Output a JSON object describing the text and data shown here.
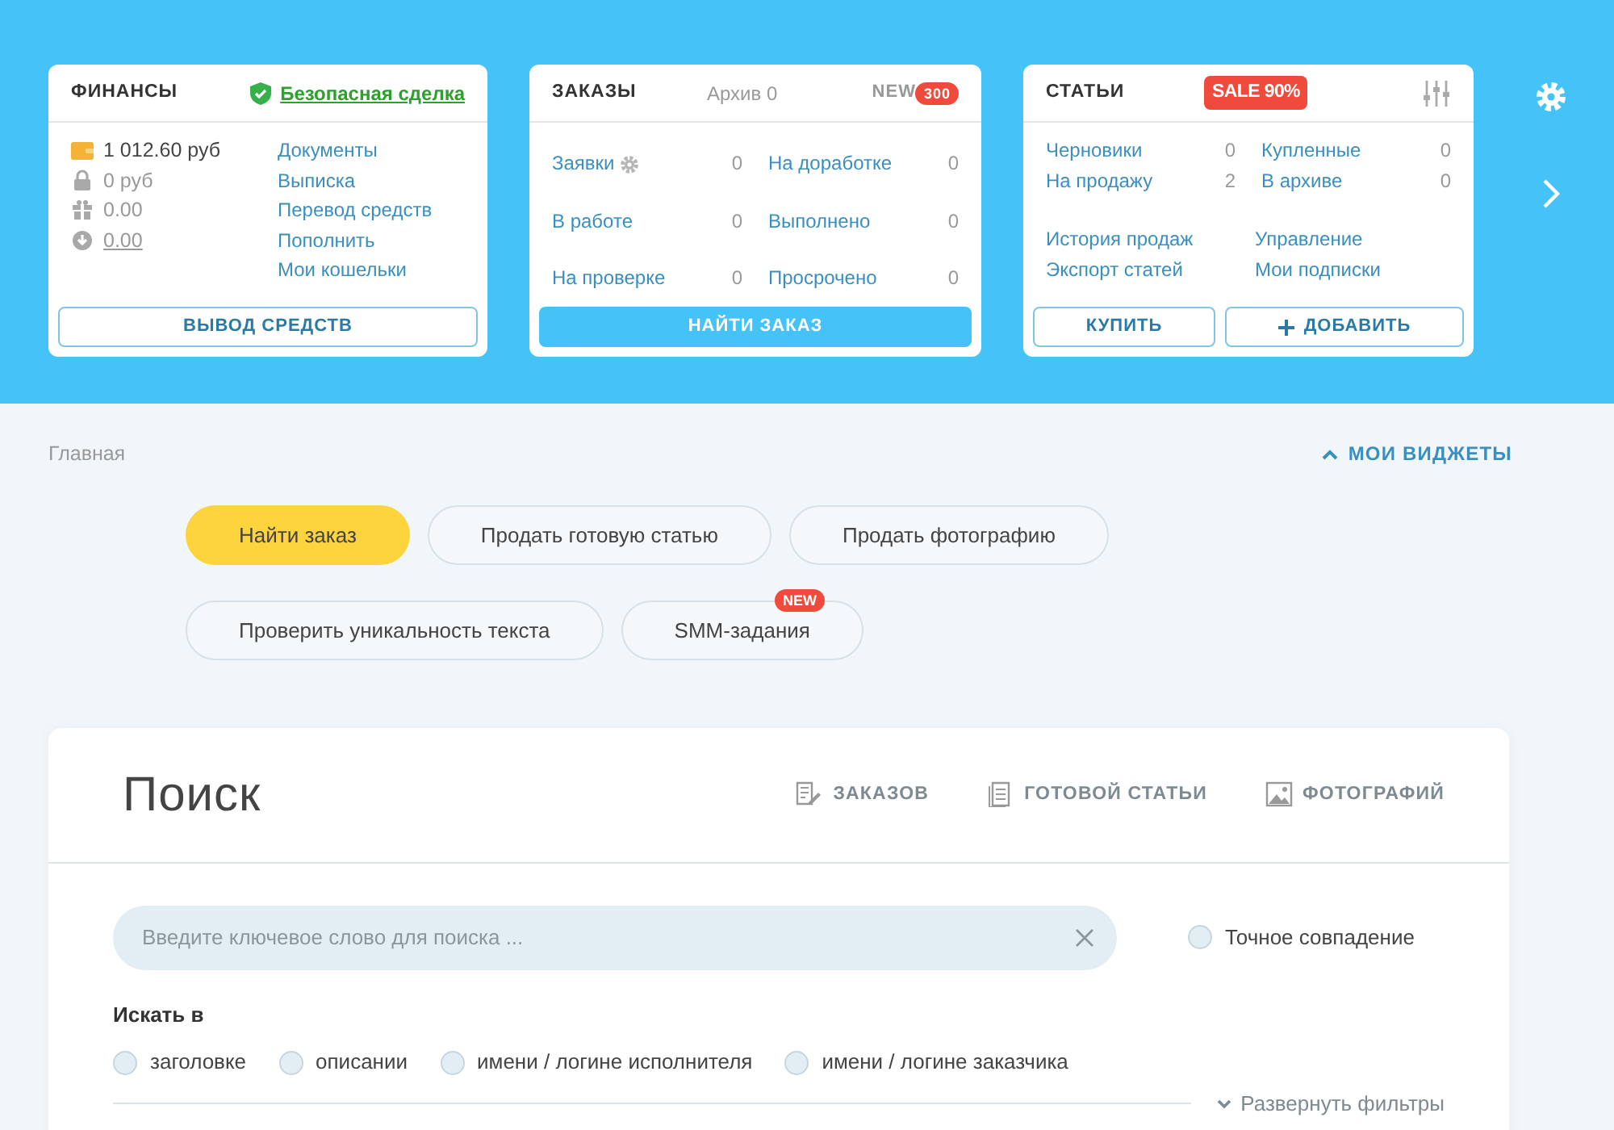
{
  "finance": {
    "title": "ФИНАНСЫ",
    "secure_link": "Безопасная сделка",
    "balances": [
      {
        "kind": "wallet",
        "value": "1 012.60 руб",
        "underlined": false
      },
      {
        "kind": "lock",
        "value": "0 руб",
        "underlined": false
      },
      {
        "kind": "gift",
        "value": "0.00",
        "underlined": false
      },
      {
        "kind": "download",
        "value": "0.00",
        "underlined": true
      }
    ],
    "links": [
      "Документы",
      "Выписка",
      "Перевод средств",
      "Пополнить",
      "Мои кошельки"
    ],
    "button": "ВЫВОД СРЕДСТВ"
  },
  "orders": {
    "title": "ЗАКАЗЫ",
    "archive": "Архив 0",
    "new_label": "NEW",
    "new_count": "300",
    "stats": [
      {
        "label": "Заявки",
        "value": "0",
        "gear": true
      },
      {
        "label": "На доработке",
        "value": "0",
        "gear": false
      },
      {
        "label": "В работе",
        "value": "0",
        "gear": false
      },
      {
        "label": "Выполнено",
        "value": "0",
        "gear": false
      },
      {
        "label": "На проверке",
        "value": "0",
        "gear": false
      },
      {
        "label": "Просрочено",
        "value": "0",
        "gear": false
      }
    ],
    "button": "НАЙТИ ЗАКАЗ"
  },
  "articles": {
    "title": "СТАТЬИ",
    "sale_badge": "SALE 90%",
    "stats": [
      {
        "label": "Черновики",
        "value": "0"
      },
      {
        "label": "Купленные",
        "value": "0"
      },
      {
        "label": "На продажу",
        "value": "2"
      },
      {
        "label": "В архиве",
        "value": "0"
      }
    ],
    "links": [
      "История продаж",
      "Управление",
      "Экспорт статей",
      "Мои подписки"
    ],
    "buttons": [
      {
        "label": "КУПИТЬ",
        "kind": "plain"
      },
      {
        "label": "ДОБАВИТЬ",
        "kind": "add"
      }
    ]
  },
  "breadcrumb": "Главная",
  "widgets_toggle": "МОИ ВИДЖЕТЫ",
  "quick_actions": [
    {
      "label": "Найти заказ",
      "selected": true
    },
    {
      "label": "Продать готовую статью",
      "selected": false
    },
    {
      "label": "Продать фотографию",
      "selected": false
    },
    {
      "label": "Проверить уникальность текста",
      "selected": false
    },
    {
      "label": "SMM-задания",
      "selected": false,
      "badge": "NEW"
    }
  ],
  "search": {
    "title": "Поиск",
    "tabs": [
      {
        "label": "ЗАКАЗОВ",
        "kind": "edit"
      },
      {
        "label": "ГОТОВОЙ СТАТЬИ",
        "kind": "doc"
      },
      {
        "label": "ФОТОГРАФИЙ",
        "kind": "image"
      }
    ],
    "placeholder": "Введите ключевое слово для поиска ...",
    "exact": {
      "label": "Точное совпадение",
      "checked": false
    },
    "scope_label": "Искать в",
    "scopes": [
      {
        "label": "заголовке",
        "checked": false
      },
      {
        "label": "описании",
        "checked": false
      },
      {
        "label": "имени / логине исполнителя",
        "checked": false
      },
      {
        "label": "имени / логине заказчика",
        "checked": false
      }
    ],
    "expand": "Развернуть фильтры"
  }
}
